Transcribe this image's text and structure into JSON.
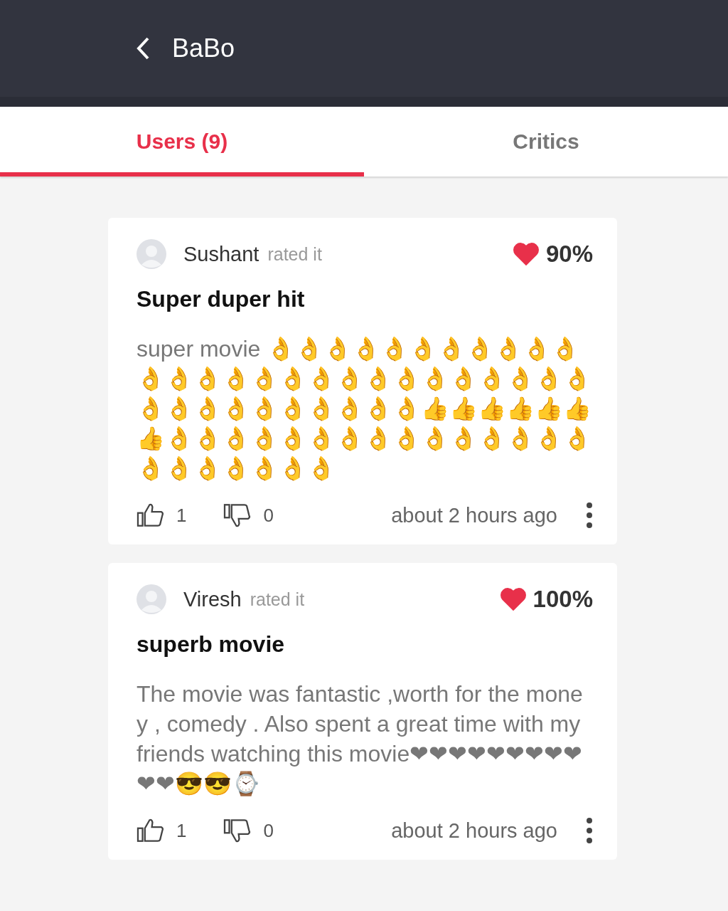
{
  "header": {
    "title": "BaBo"
  },
  "tabs": [
    {
      "label": "Users (9)",
      "selected": true
    },
    {
      "label": "Critics",
      "selected": false
    }
  ],
  "reviews": [
    {
      "user": "Sushant",
      "action": "rated it",
      "rating": "90%",
      "title": "Super duper hit",
      "body": "super movie 👌👌👌👌👌👌👌👌👌👌👌👌👌👌👌👌👌👌👌👌👌👌👌👌👌👌👌👌👌👌👌👌👌👌👌👌👌👍👍👍👍👍👍👍👌👌👌👌👌👌👌👌👌👌👌👌👌👌👌👌👌👌👌👌👌👌",
      "likes": "1",
      "dislikes": "0",
      "time": "about 2 hours ago"
    },
    {
      "user": "Viresh",
      "action": "rated it",
      "rating": "100%",
      "title": "superb movie",
      "body": "The movie was fantastic ,worth for the money , comedy . Also spent a great time with my friends watching this movie❤❤❤❤❤❤❤❤❤❤❤😎😎⌚",
      "likes": "1",
      "dislikes": "0",
      "time": "about 2 hours ago"
    }
  ]
}
